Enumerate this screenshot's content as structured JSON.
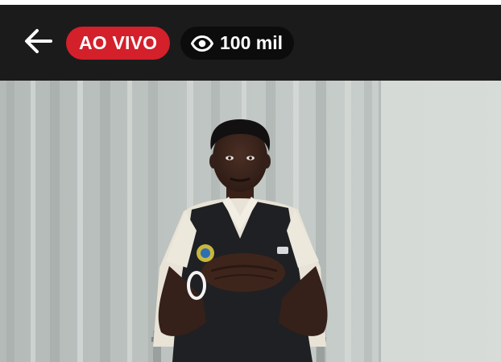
{
  "header": {
    "back_icon": "arrow-left-icon",
    "live_label": "AO VIVO",
    "viewer_icon": "eye-icon",
    "viewer_count": "100 mil"
  },
  "video": {
    "content": "live-video-frame"
  },
  "colors": {
    "header_bg": "#1b1b1b",
    "live_badge": "#d3202b",
    "viewer_badge_bg": "#0c0c0c",
    "text": "#ffffff"
  }
}
